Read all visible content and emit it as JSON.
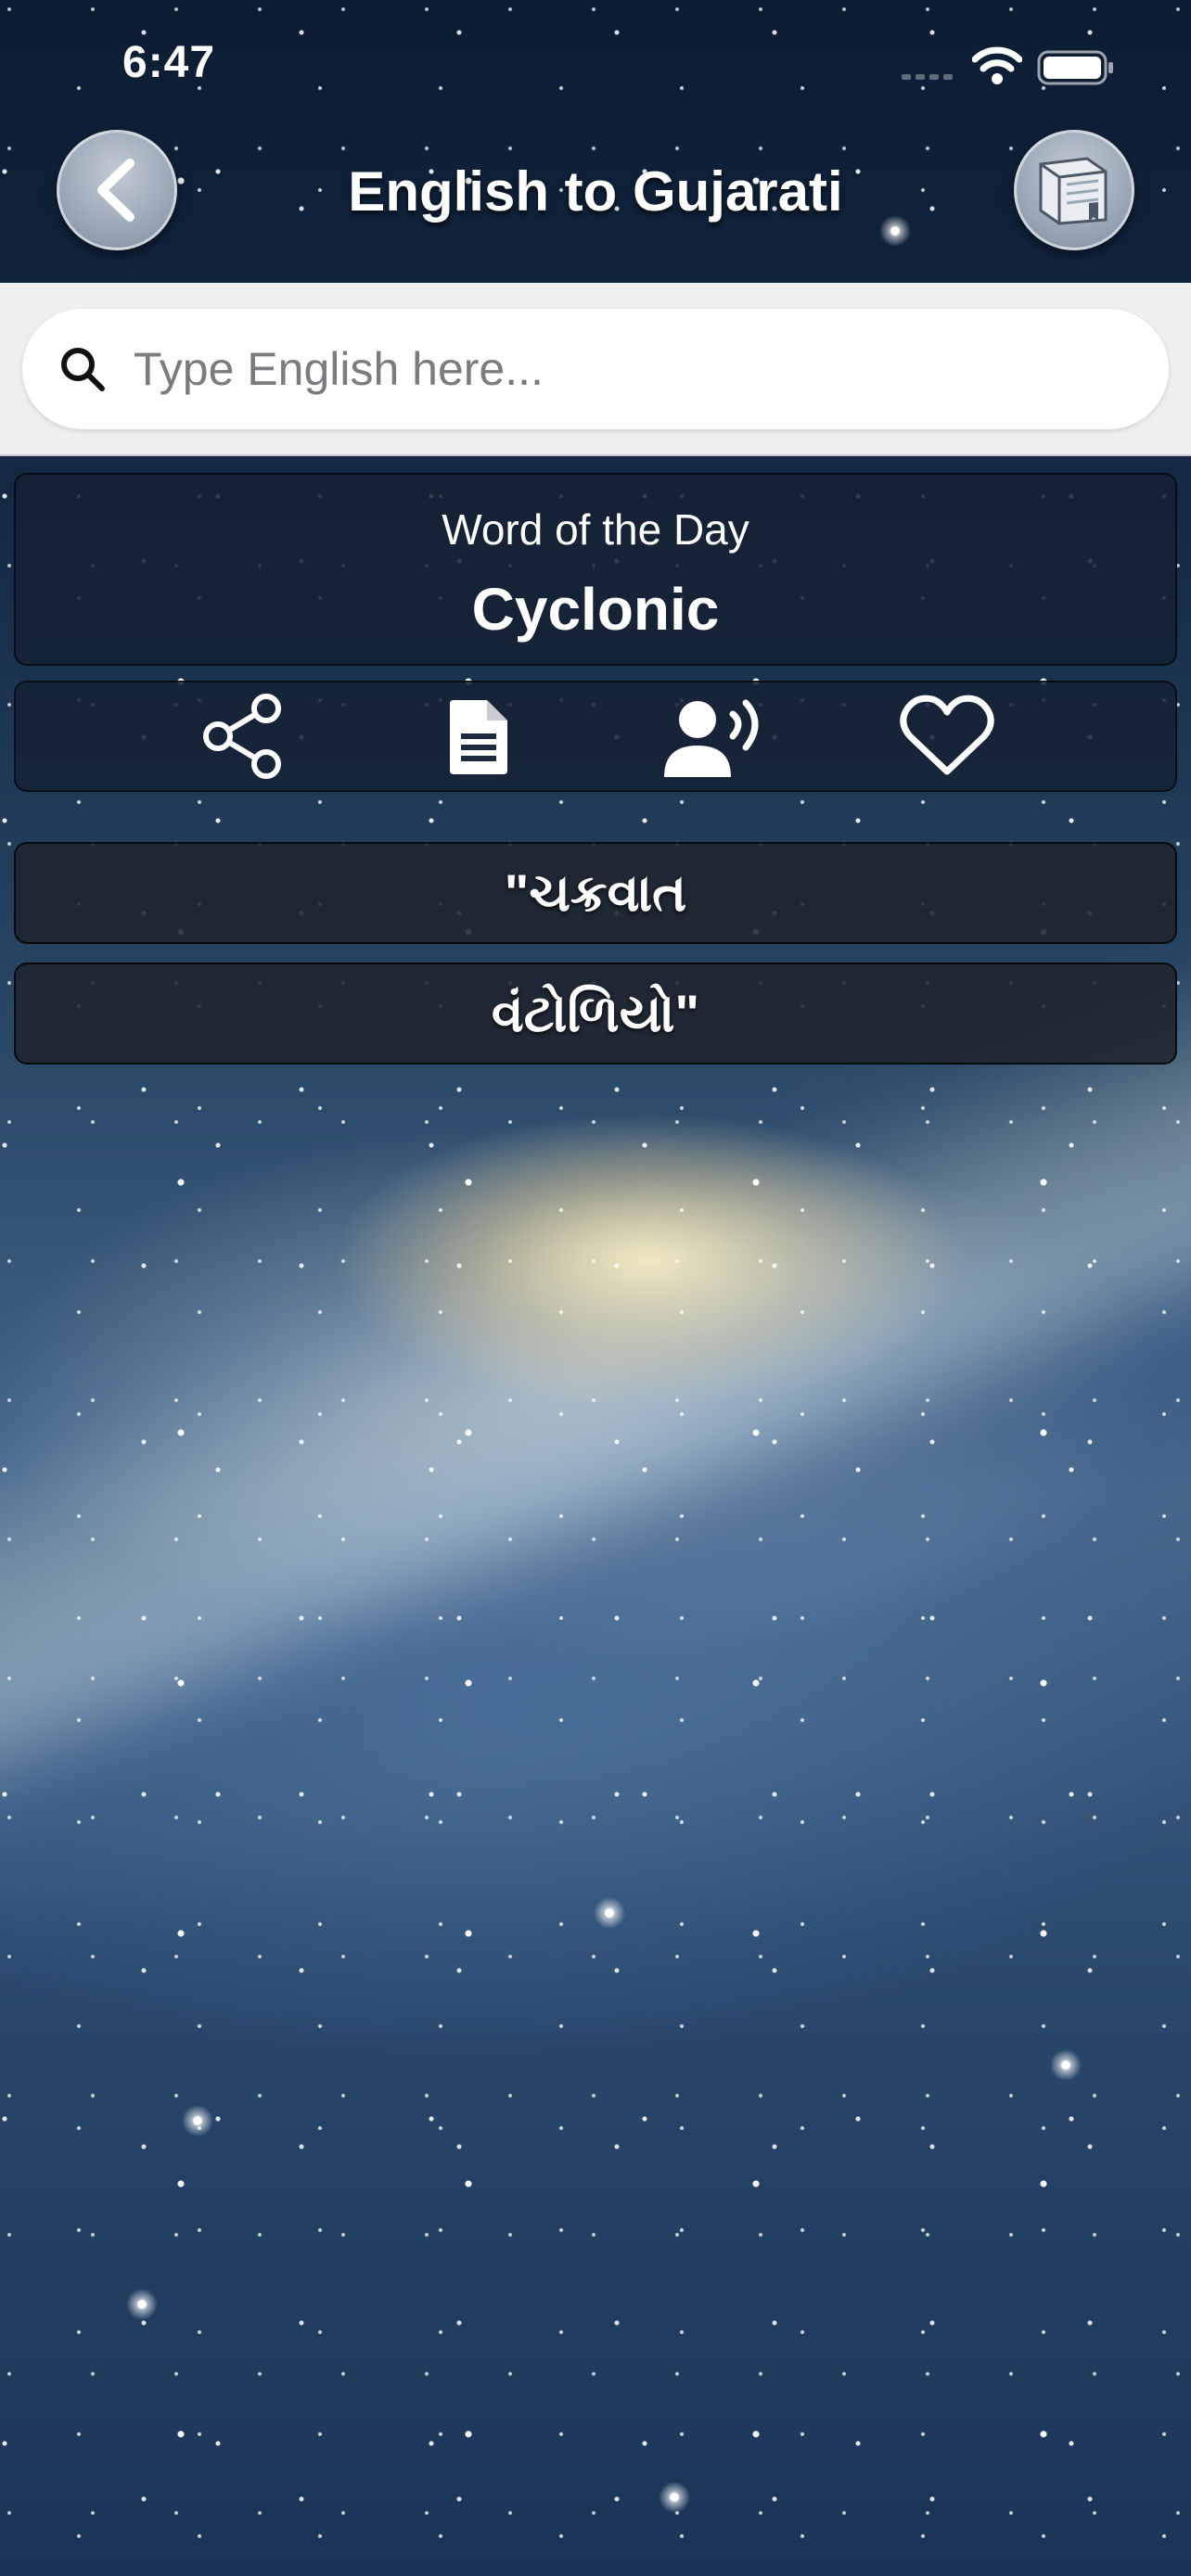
{
  "status_bar": {
    "time": "6:47"
  },
  "header": {
    "title": "English to Gujarati",
    "back_icon": "chevron-left-icon",
    "right_icon": "book-icon"
  },
  "search": {
    "placeholder": "Type English here...",
    "value": ""
  },
  "word_of_the_day": {
    "label": "Word of the Day",
    "word": "Cyclonic"
  },
  "actions": [
    {
      "icon": "share-icon"
    },
    {
      "icon": "document-icon"
    },
    {
      "icon": "speak-icon"
    },
    {
      "icon": "heart-icon"
    }
  ],
  "translations": [
    "\"ચક્રવાત",
    "વંટોળિયો\""
  ],
  "colors": {
    "search_bar_bg": "#efeff2",
    "panel_bg": "#162234",
    "button_gray": "#93a1b0"
  }
}
